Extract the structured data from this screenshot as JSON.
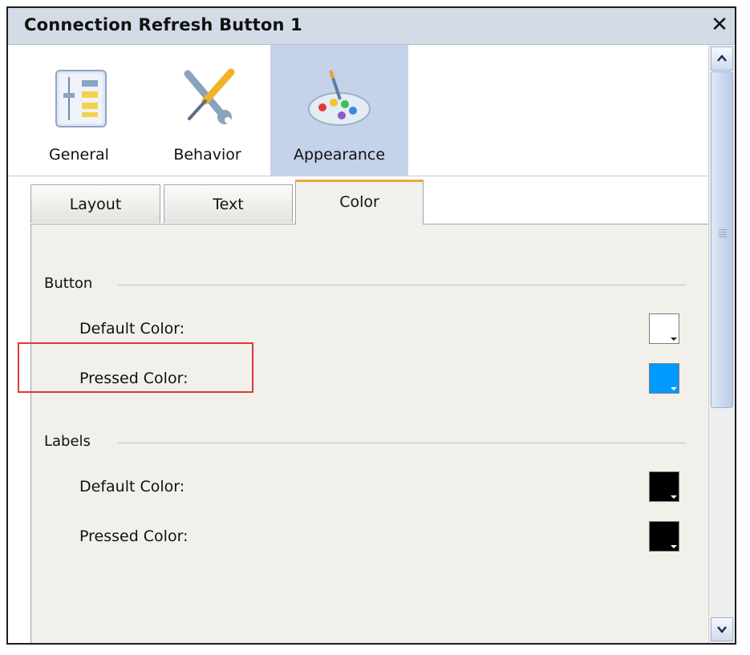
{
  "window": {
    "title": "Connection Refresh Button 1",
    "close_symbol": "✕"
  },
  "categories": [
    {
      "label": "General",
      "icon": "general-settings-icon",
      "selected": false
    },
    {
      "label": "Behavior",
      "icon": "wrench-screwdriver-icon",
      "selected": false
    },
    {
      "label": "Appearance",
      "icon": "paint-palette-icon",
      "selected": true
    }
  ],
  "tabs": [
    {
      "label": "Layout",
      "active": false
    },
    {
      "label": "Text",
      "active": false
    },
    {
      "label": "Color",
      "active": true
    }
  ],
  "button_section": {
    "title": "Button",
    "default_color_label": "Default Color:",
    "default_color_value": "#ffffff",
    "pressed_color_label": "Pressed Color:",
    "pressed_color_value": "#0099ff"
  },
  "labels_section": {
    "title": "Labels",
    "default_color_label": "Default Color:",
    "default_color_value": "#000000",
    "pressed_color_label": "Pressed Color:",
    "pressed_color_value": "#000000"
  },
  "colors": {
    "title_bar": "#d3dbe6",
    "selected_category": "#c5d3ea",
    "active_tab_accent": "#f0a540",
    "tab_page_bg": "#f1f0eb",
    "highlight_border": "#d93a3a"
  }
}
